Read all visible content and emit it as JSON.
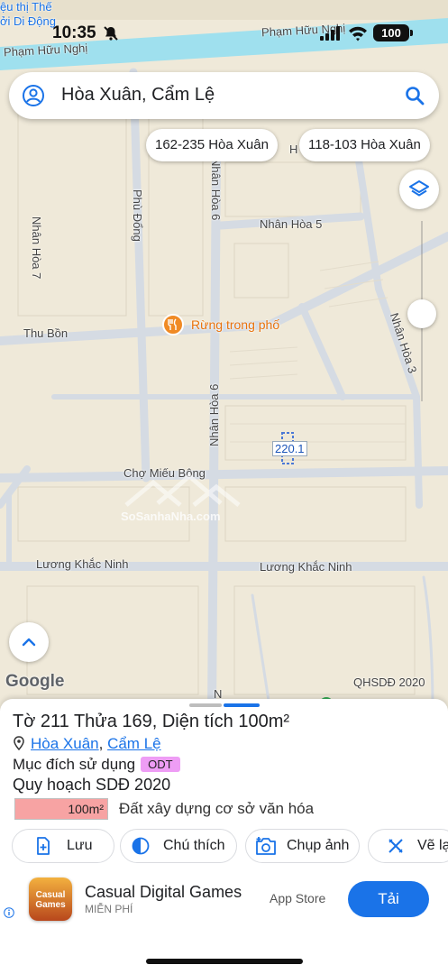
{
  "status_bar": {
    "time": "10:35",
    "battery": "100"
  },
  "search": {
    "query": "Hòa Xuân, Cẩm Lệ"
  },
  "chips": [
    "162-235 Hòa Xuân",
    "118-103 Hòa Xuân"
  ],
  "map": {
    "top_labels": [
      "ệu thị Thế",
      "ởi Di Động"
    ],
    "streets": {
      "pham_huu_nghi_left": "Phạm Hữu Nghị",
      "pham_huu_nghi_right": "Phạm Hữu Nghị",
      "nhan_hoa_7": "Nhân Hòa 7",
      "phu_dong": "Phù Đổng",
      "nhan_hoa_6": "Nhân Hòa 6",
      "h_partial": "H",
      "nhan_hoa_5": "Nhân Hòa 5",
      "thu_bon": "Thu Bồn",
      "nhan_hoa_3": "Nhân Hòa 3",
      "nhan_hoa_6_lower": "Nhân Hòa 6",
      "cho_mieu_bon": "Chợ Miếu Bông",
      "luong_khac_ninh_left": "Lương Khắc Ninh",
      "luong_khac_ninh_right": "Lương Khắc Ninh",
      "n_partial": "N"
    },
    "poi": "Rừng trong phố",
    "parcel": "220.1",
    "watermark": "SoSanhaNha.com",
    "google": "Google",
    "source": "QHSDĐ 2020"
  },
  "sheet": {
    "title": "Tờ 211 Thửa 169, Diện tích 100m²",
    "location": {
      "ward": "Hòa Xuân",
      "separator": ", ",
      "district": "Cẩm Lệ"
    },
    "purpose_label": "Mục đích sử dụng",
    "purpose_badge": "ODT",
    "plan_title": "Quy hoạch SDĐ 2020",
    "legend": {
      "area": "100m²",
      "description": "Đất xây dựng cơ sở văn hóa",
      "color": "#f7a3a3"
    },
    "actions": {
      "save": "Lưu",
      "note": "Chú thích",
      "screenshot": "Chụp ảnh",
      "draw": "Vẽ lại"
    }
  },
  "ad": {
    "thumb_text": "Casual Games",
    "name": "Casual Digital Games",
    "subtitle": "MIỄN PHÍ",
    "store": "App Store",
    "install": "Tải"
  },
  "colors": {
    "accent": "#1a73e8",
    "canal": "#9fe0ee",
    "road": "#d5dbe3",
    "land": "#efe9d9"
  }
}
